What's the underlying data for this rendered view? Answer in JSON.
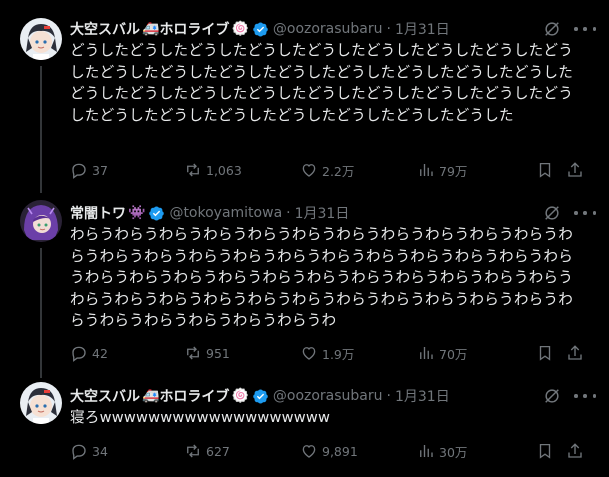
{
  "tweets": [
    {
      "name": "大空スバル",
      "name_emoji": "🚑",
      "name_suffix": "ホロライブ",
      "name_badge": "🍥",
      "handle": "@oozorasubaru",
      "date": "1月31日",
      "text": "どうしたどうしたどうしたどうしたどうしたどうしたどうしたどうしたどうしたどうしたどうしたどうしたどうしたどうしたどうしたどうしたどうしたどうしたどうしたどうしたどうしたどうしたどうしたどうしたどうしたどうしたどうしたどうしたどうしたどうしたどうしたどうしたどうした",
      "replies": "37",
      "reposts": "1,063",
      "likes": "2.2万",
      "views": "79万"
    },
    {
      "name": "常闇トワ",
      "name_emoji": "👾",
      "handle": "@tokoyamitowa",
      "date": "1月31日",
      "text": "わらうわらうわらうわらうわらうわらうわらうわらうわらうわらうわらうわらうわらうわらうわらうわらうわらうわらうわらうわらうわらうわらうわらうわらうわらうわらうわらうわらうわらうわらうわらうわらうわらうわらうわらうわらうわらうわらうわらうわらうわらうわらうわらうわらうわらうわらうわらうわらうわらうわらうわらうわ",
      "replies": "42",
      "reposts": "951",
      "likes": "1.9万",
      "views": "70万"
    },
    {
      "name": "大空スバル",
      "name_emoji": "🚑",
      "name_suffix": "ホロライブ",
      "name_badge": "🍥",
      "handle": "@oozorasubaru",
      "date": "1月31日",
      "text": "寝ろwwwwwwwwwwwwwwwwwww",
      "replies": "34",
      "reposts": "627",
      "likes": "9,891",
      "views": "30万"
    }
  ],
  "colors": {
    "background": "#000000",
    "text": "#e7e9ea",
    "muted": "#71767b",
    "verified": "#1d9bf0",
    "thread_line": "#333639"
  }
}
